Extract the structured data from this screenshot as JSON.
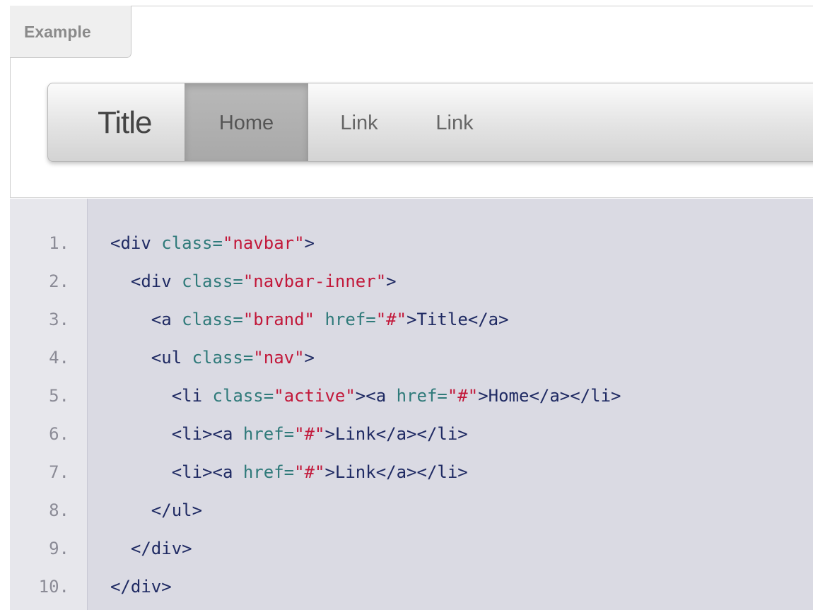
{
  "example_tab": {
    "label": "Example"
  },
  "navbar": {
    "brand": "Title",
    "items": [
      {
        "label": "Home",
        "active": true
      },
      {
        "label": "Link",
        "active": false
      },
      {
        "label": "Link",
        "active": false
      }
    ]
  },
  "code": {
    "line_numbers": [
      "1.",
      "2.",
      "3.",
      "4.",
      "5.",
      "6.",
      "7.",
      "8.",
      "9.",
      "10."
    ],
    "lines": [
      [
        {
          "t": "tag",
          "v": "<div "
        },
        {
          "t": "attr",
          "v": "class="
        },
        {
          "t": "str",
          "v": "\"navbar\""
        },
        {
          "t": "tag",
          "v": ">"
        }
      ],
      [
        {
          "t": "tag",
          "v": "  <div "
        },
        {
          "t": "attr",
          "v": "class="
        },
        {
          "t": "str",
          "v": "\"navbar-inner\""
        },
        {
          "t": "tag",
          "v": ">"
        }
      ],
      [
        {
          "t": "tag",
          "v": "    <a "
        },
        {
          "t": "attr",
          "v": "class="
        },
        {
          "t": "str",
          "v": "\"brand\""
        },
        {
          "t": "attr",
          "v": " href="
        },
        {
          "t": "str",
          "v": "\"#\""
        },
        {
          "t": "tag",
          "v": ">"
        },
        {
          "t": "txt",
          "v": "Title"
        },
        {
          "t": "tag",
          "v": "</a>"
        }
      ],
      [
        {
          "t": "tag",
          "v": "    <ul "
        },
        {
          "t": "attr",
          "v": "class="
        },
        {
          "t": "str",
          "v": "\"nav\""
        },
        {
          "t": "tag",
          "v": ">"
        }
      ],
      [
        {
          "t": "tag",
          "v": "      <li "
        },
        {
          "t": "attr",
          "v": "class="
        },
        {
          "t": "str",
          "v": "\"active\""
        },
        {
          "t": "tag",
          "v": "><a "
        },
        {
          "t": "attr",
          "v": "href="
        },
        {
          "t": "str",
          "v": "\"#\""
        },
        {
          "t": "tag",
          "v": ">"
        },
        {
          "t": "txt",
          "v": "Home"
        },
        {
          "t": "tag",
          "v": "</a></li>"
        }
      ],
      [
        {
          "t": "tag",
          "v": "      <li><a "
        },
        {
          "t": "attr",
          "v": "href="
        },
        {
          "t": "str",
          "v": "\"#\""
        },
        {
          "t": "tag",
          "v": ">"
        },
        {
          "t": "txt",
          "v": "Link"
        },
        {
          "t": "tag",
          "v": "</a></li>"
        }
      ],
      [
        {
          "t": "tag",
          "v": "      <li><a "
        },
        {
          "t": "attr",
          "v": "href="
        },
        {
          "t": "str",
          "v": "\"#\""
        },
        {
          "t": "tag",
          "v": ">"
        },
        {
          "t": "txt",
          "v": "Link"
        },
        {
          "t": "tag",
          "v": "</a></li>"
        }
      ],
      [
        {
          "t": "tag",
          "v": "    </ul>"
        }
      ],
      [
        {
          "t": "tag",
          "v": "  </div>"
        }
      ],
      [
        {
          "t": "tag",
          "v": "</div>"
        }
      ]
    ]
  }
}
